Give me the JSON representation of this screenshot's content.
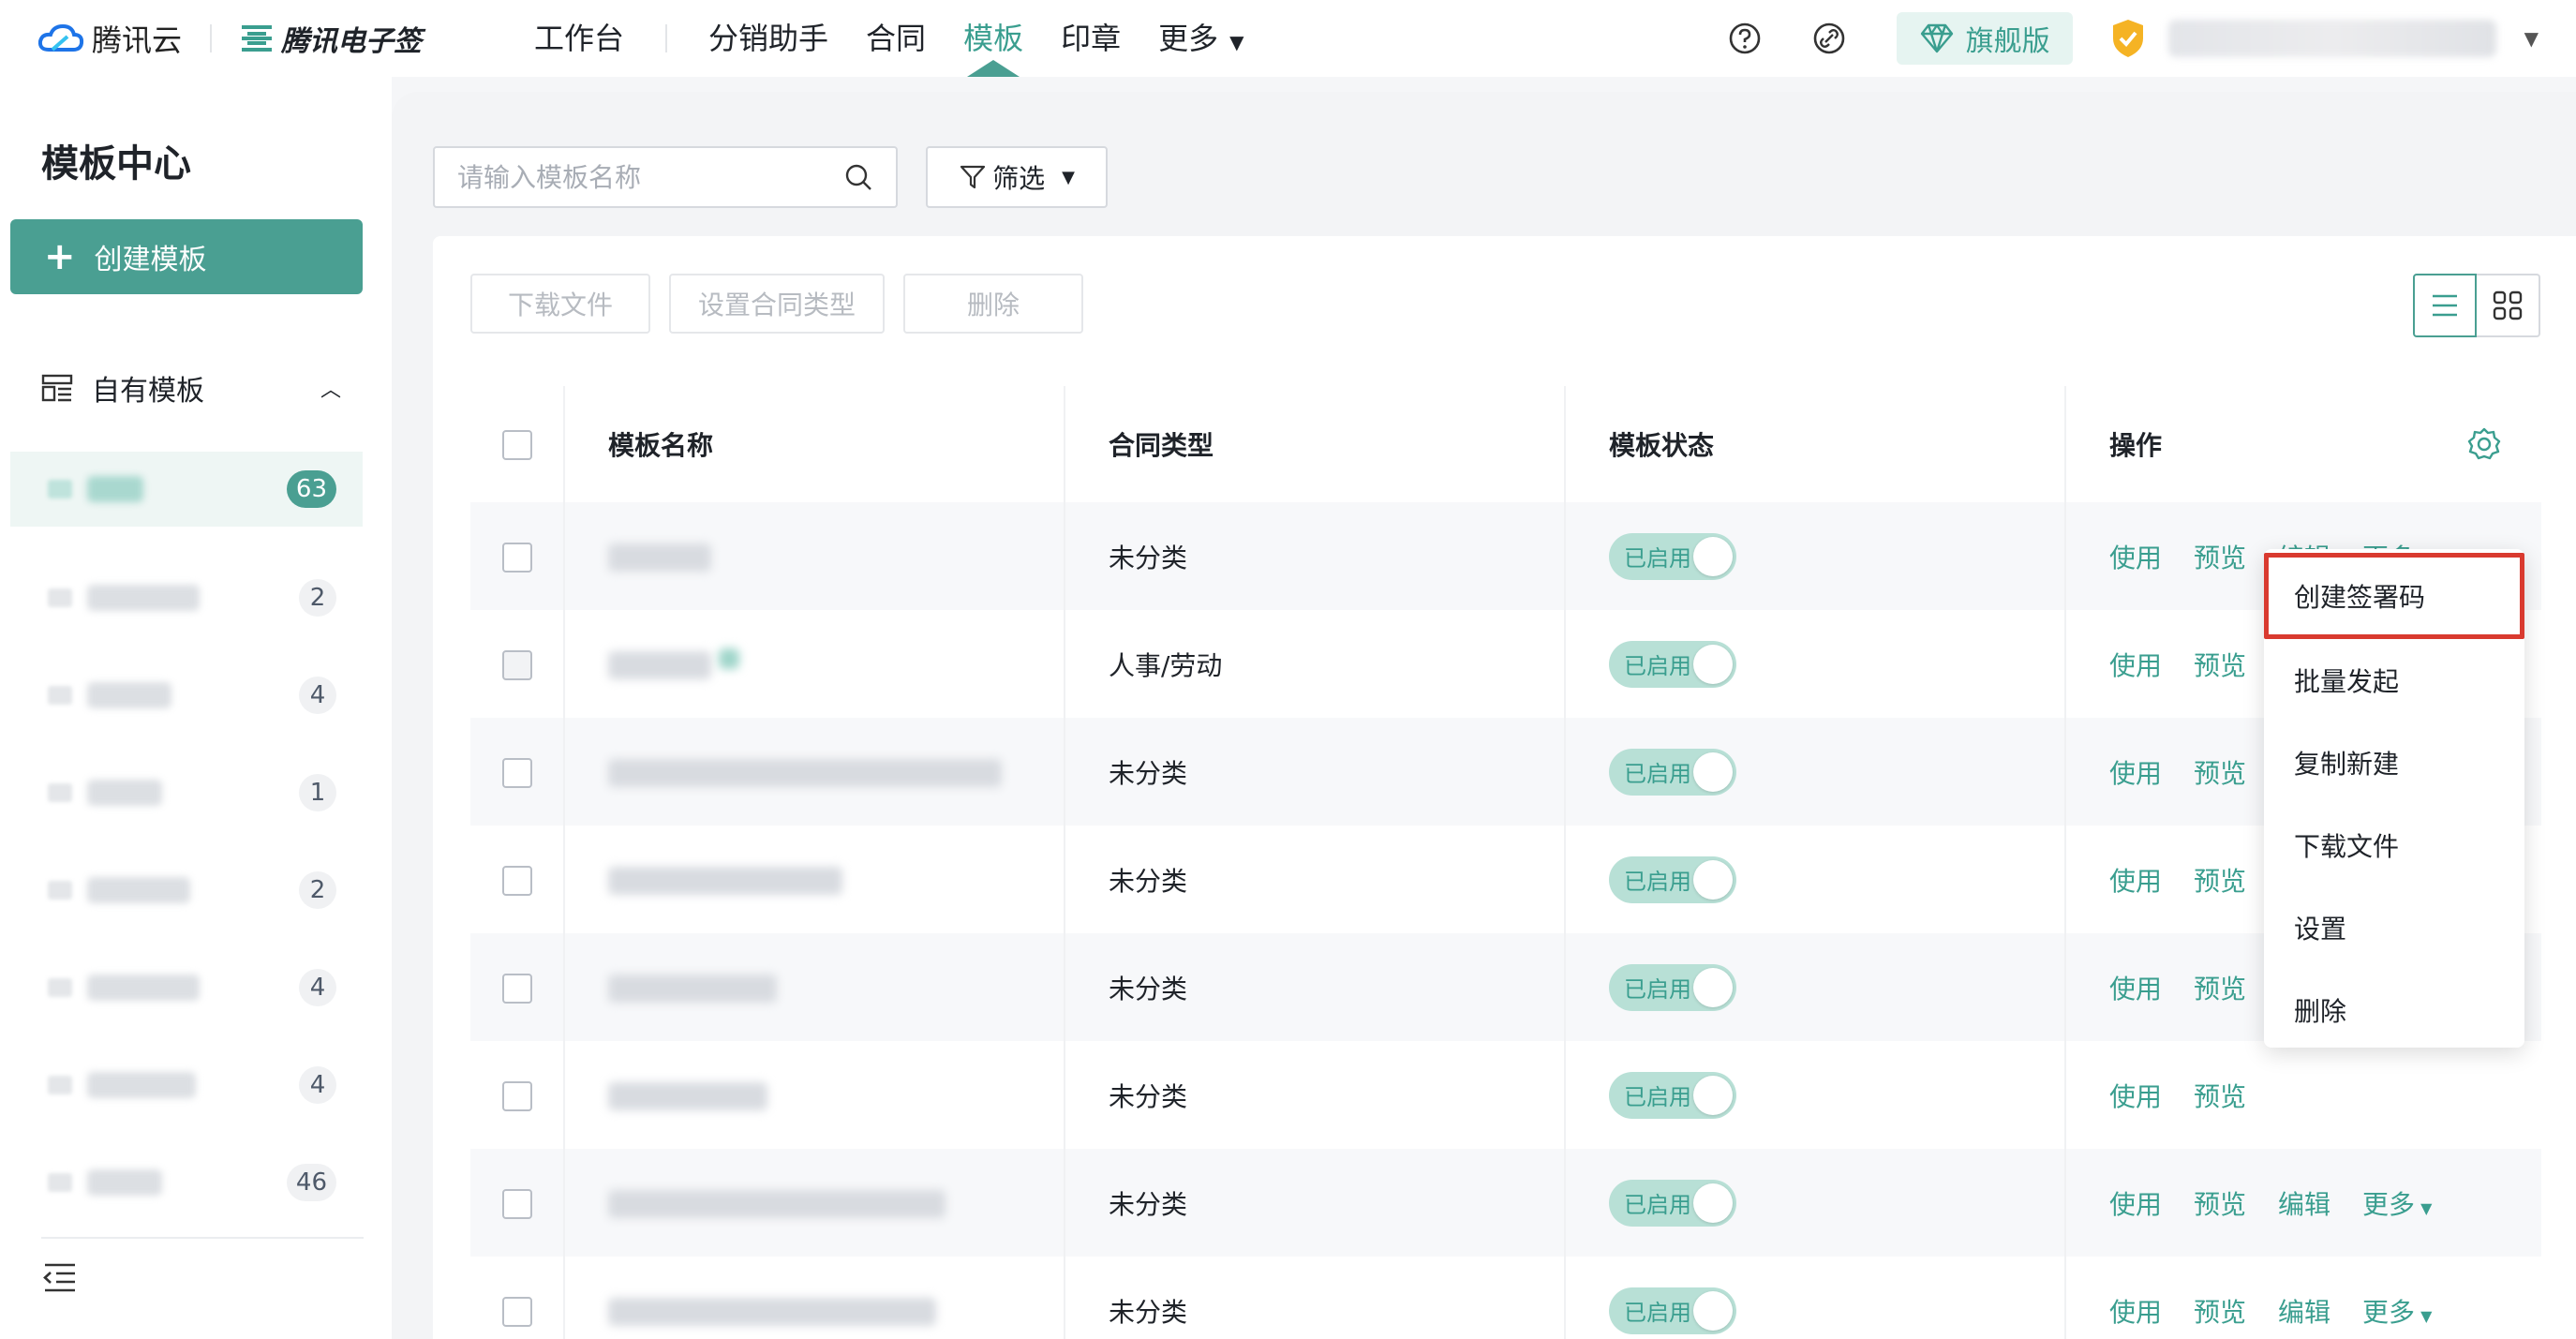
{
  "brand": {
    "cloud_name": "腾讯云",
    "product_name": "腾讯电子签"
  },
  "nav": {
    "items": [
      {
        "label": "工作台"
      },
      {
        "label": "分销助手"
      },
      {
        "label": "合同"
      },
      {
        "label": "模板",
        "active": true
      },
      {
        "label": "印章"
      },
      {
        "label": "更多"
      }
    ]
  },
  "top_right": {
    "plan_label": "旗舰版"
  },
  "sidebar": {
    "title": "模板中心",
    "create_label": "创建模板",
    "group_label": "自有模板",
    "folders": [
      {
        "count": "63",
        "active": true
      },
      {
        "count": "2"
      },
      {
        "count": "4"
      },
      {
        "count": "1"
      },
      {
        "count": "2"
      },
      {
        "count": "4"
      },
      {
        "count": "4"
      },
      {
        "count": "46"
      }
    ]
  },
  "search": {
    "placeholder": "请输入模板名称"
  },
  "filter": {
    "label": "筛选"
  },
  "toolbar": {
    "download": "下载文件",
    "set_type": "设置合同类型",
    "delete": "删除"
  },
  "table": {
    "headers": {
      "name": "模板名称",
      "type": "合同类型",
      "state": "模板状态",
      "op": "操作"
    },
    "rows": [
      {
        "type": "未分类",
        "state": "已启用"
      },
      {
        "type": "人事/劳动",
        "state": "已启用"
      },
      {
        "type": "未分类",
        "state": "已启用"
      },
      {
        "type": "未分类",
        "state": "已启用"
      },
      {
        "type": "未分类",
        "state": "已启用"
      },
      {
        "type": "未分类",
        "state": "已启用"
      },
      {
        "type": "未分类",
        "state": "已启用"
      },
      {
        "type": "未分类",
        "state": "已启用"
      }
    ],
    "ops": {
      "use": "使用",
      "preview": "预览",
      "edit": "编辑",
      "more": "更多"
    }
  },
  "dropdown": {
    "items": [
      "创建签署码",
      "批量发起",
      "复制新建",
      "下载文件",
      "设置",
      "删除"
    ]
  },
  "colors": {
    "accent": "#4a9f92",
    "highlight": "#d93a2f"
  }
}
